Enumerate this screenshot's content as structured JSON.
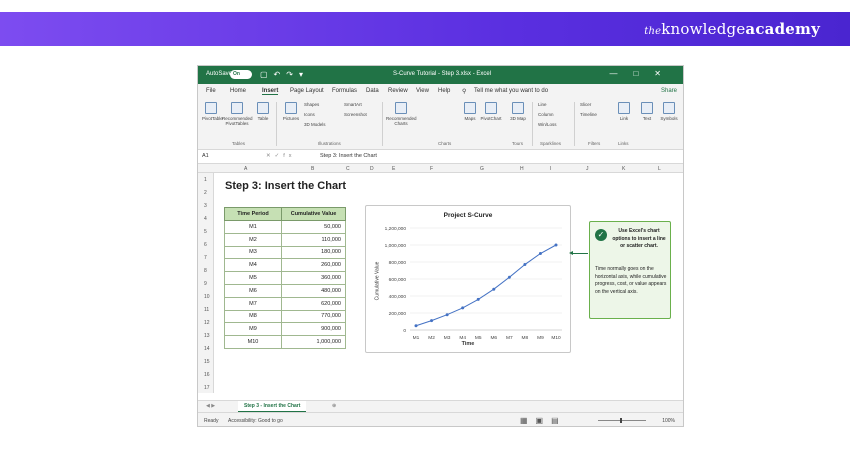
{
  "brand": {
    "the": "the",
    "knowledge": "knowledge",
    "academy": "academy"
  },
  "titlebar": {
    "autosave": "AutoSave",
    "toggle": "On",
    "title": "S-Curve Tutorial - Step 3.xlsx - Excel"
  },
  "menu": [
    "File",
    "Home",
    "Insert",
    "Page Layout",
    "Formulas",
    "Data",
    "Review",
    "View",
    "Help"
  ],
  "search": "Tell me what you want to do",
  "share": "Share",
  "ribbon": {
    "items": [
      "PivotTable",
      "Recommended PivotTables",
      "Table",
      "Pictures",
      "Shapes",
      "Icons",
      "3D Models",
      "SmartArt",
      "Screenshot",
      "Recommended Charts",
      "Maps",
      "PivotChart",
      "3D Map",
      "Line",
      "Column",
      "Win/Loss",
      "Slicer",
      "Timeline",
      "Link",
      "Text",
      "Symbols"
    ],
    "groups": [
      "Tables",
      "Illustrations",
      "Charts",
      "Tours",
      "Sparklines",
      "Filters",
      "Links"
    ]
  },
  "formulabar": {
    "namebox": "A1",
    "fx": "fx",
    "formula": "Step 3: Insert the Chart"
  },
  "columns": [
    "A",
    "B",
    "C",
    "D",
    "E",
    "F",
    "G",
    "H",
    "I",
    "J",
    "K",
    "L"
  ],
  "rows": [
    "1",
    "2",
    "3",
    "4",
    "5",
    "6",
    "7",
    "8",
    "9",
    "10",
    "11",
    "12",
    "13",
    "14",
    "15",
    "16",
    "17"
  ],
  "sheet_title": "Step 3: Insert the Chart",
  "table": {
    "headers": [
      "Time Period",
      "Cumulative Value"
    ],
    "rows": [
      [
        "M1",
        "50,000"
      ],
      [
        "M2",
        "110,000"
      ],
      [
        "M3",
        "180,000"
      ],
      [
        "M4",
        "260,000"
      ],
      [
        "M5",
        "360,000"
      ],
      [
        "M6",
        "480,000"
      ],
      [
        "M7",
        "620,000"
      ],
      [
        "M8",
        "770,000"
      ],
      [
        "M9",
        "900,000"
      ],
      [
        "M10",
        "1,000,000"
      ]
    ]
  },
  "chart_data": {
    "type": "line",
    "title": "Project S-Curve",
    "xlabel": "Time",
    "ylabel": "Cumulative Value",
    "categories": [
      "M1",
      "M2",
      "M3",
      "M4",
      "M5",
      "M6",
      "M7",
      "M8",
      "M9",
      "M10"
    ],
    "values": [
      50000,
      110000,
      180000,
      260000,
      360000,
      480000,
      620000,
      770000,
      900000,
      1000000
    ],
    "yticks": [
      "0",
      "200,000",
      "400,000",
      "600,000",
      "800,000",
      "1,000,000",
      "1,200,000"
    ],
    "ylim": [
      0,
      1200000
    ],
    "color": "#4472c4"
  },
  "callout": {
    "head": "Use Excel's chart options to insert a line or scatter chart.",
    "body": "Time normally goes on the horizontal axis, while cumulative progress, cost, or value appears on the vertical axis."
  },
  "sheet_tab": "Step 3 - Insert the Chart",
  "status": {
    "ready": "Ready",
    "accessibility": "Accessibility: Good to go",
    "zoom": "100%"
  }
}
